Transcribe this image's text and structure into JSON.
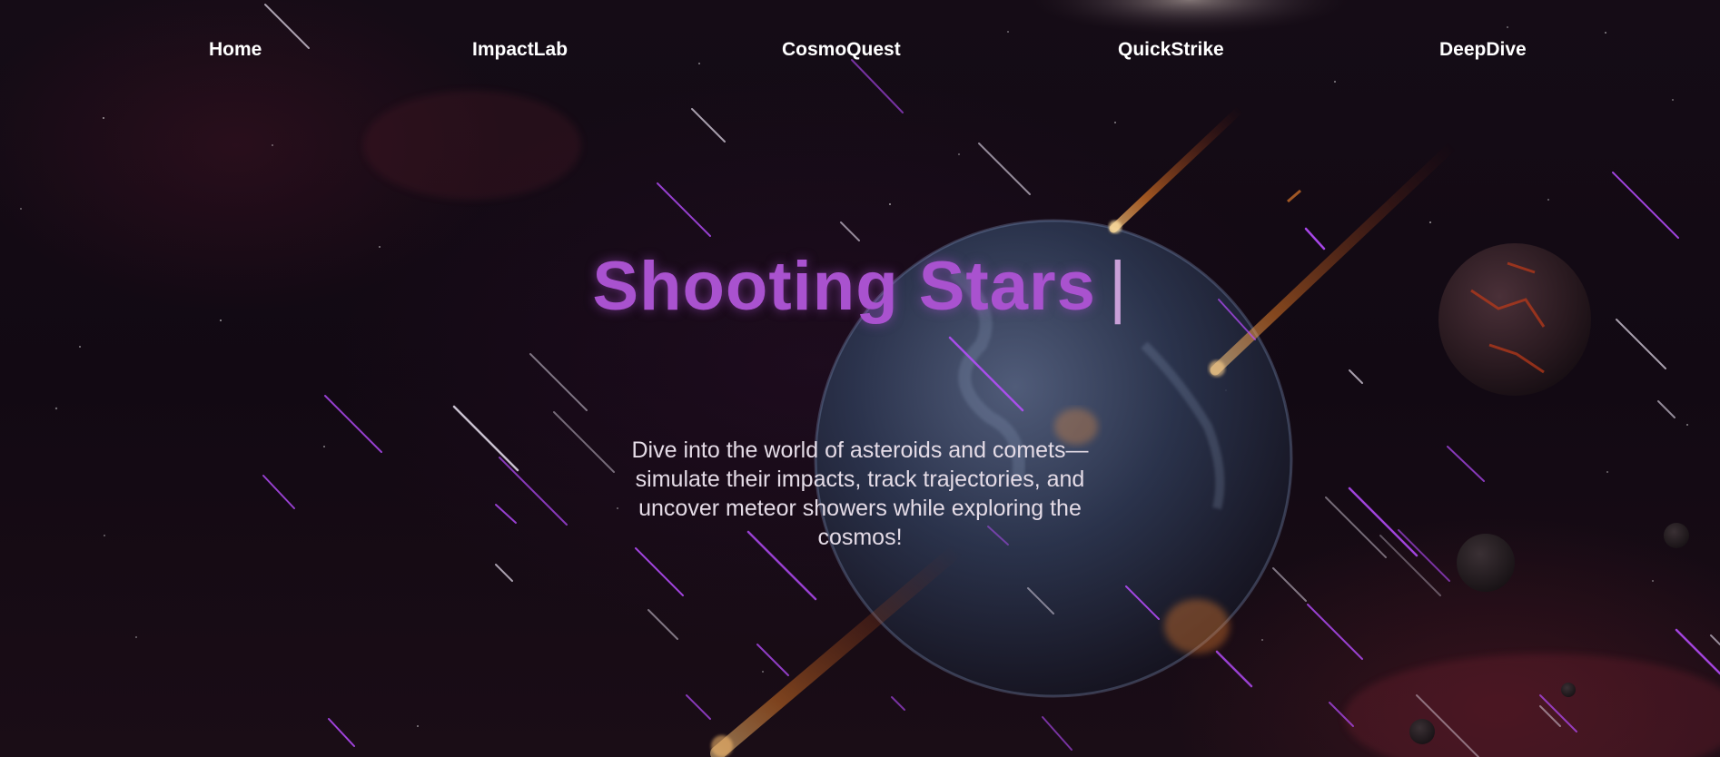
{
  "nav": {
    "items": [
      {
        "label": "Home"
      },
      {
        "label": "ImpactLab"
      },
      {
        "label": "CosmoQuest"
      },
      {
        "label": "QuickStrike"
      },
      {
        "label": "DeepDive"
      }
    ]
  },
  "hero": {
    "title": "Shooting Stars",
    "caret": "|",
    "description": "Dive into the world of asteroids and comets—simulate their impacts, track trajectories, and uncover meteor showers while exploring the cosmos!"
  },
  "colors": {
    "title": "#a952cf",
    "nav_text": "#ffffff",
    "body_text": "#e4dbe6",
    "streak_purple": "#b84dff",
    "streak_white": "#e8e0f0",
    "background": "#120913"
  }
}
